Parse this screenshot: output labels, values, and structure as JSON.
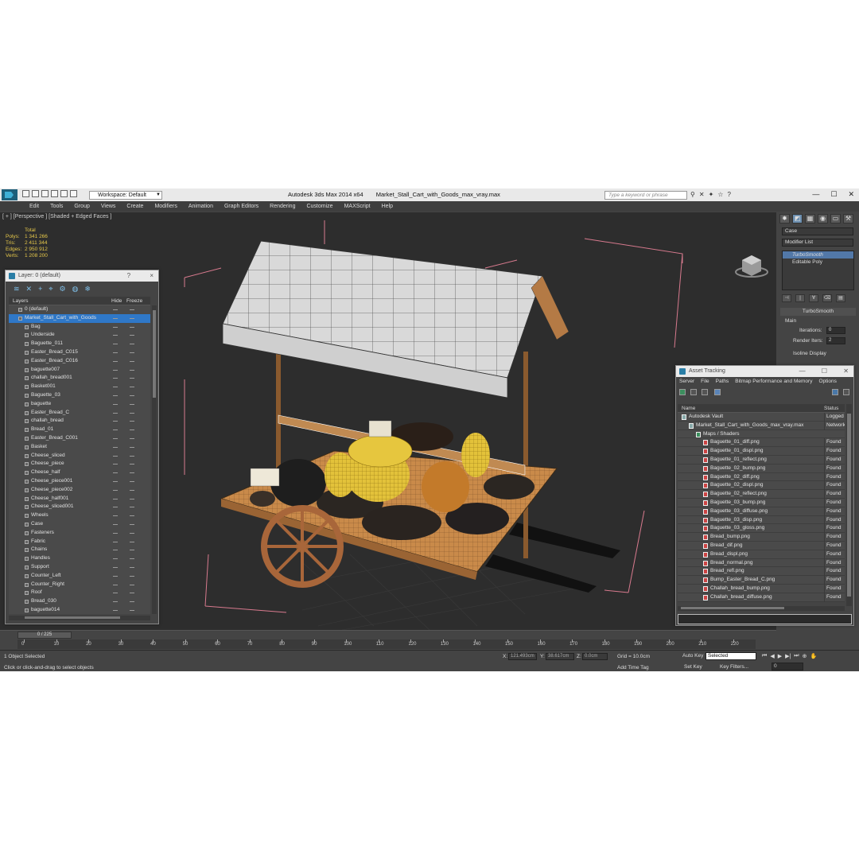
{
  "titlebar": {
    "workspace": "Workspace: Default",
    "app_title": "Autodesk 3ds Max  2014 x64",
    "file_name": "Market_Stall_Cart_with_Goods_max_vray.max",
    "search_placeholder": "Type a keyword or phrase"
  },
  "menu": [
    "Edit",
    "Tools",
    "Group",
    "Views",
    "Create",
    "Modifiers",
    "Animation",
    "Graph Editors",
    "Rendering",
    "Customize",
    "MAXScript",
    "Help"
  ],
  "viewport": {
    "label": "[ + ] [Perspective ] [Shaded + Edged Faces ]",
    "stats_header": "Total",
    "stats": [
      {
        "k": "Polys:",
        "v": "1 341 266"
      },
      {
        "k": "Tris:",
        "v": "2 411 344"
      },
      {
        "k": "Edges:",
        "v": "2 950 912"
      },
      {
        "k": "Verts:",
        "v": "1 208 200"
      }
    ]
  },
  "layer_panel": {
    "title": "Layer: 0 (default)",
    "help": "?",
    "close": "×",
    "col_layers": "Layers",
    "col_hide": "Hide",
    "col_freeze": "Freeze",
    "rows": [
      {
        "label": "0 (default)",
        "top": true
      },
      {
        "label": "Market_Stall_Cart_with_Goods",
        "top": true,
        "selected": true
      },
      {
        "label": "Bag"
      },
      {
        "label": "Underside"
      },
      {
        "label": "Baguette_011"
      },
      {
        "label": "Easter_Bread_C015"
      },
      {
        "label": "Easter_Bread_C016"
      },
      {
        "label": "baguette007"
      },
      {
        "label": "challah_bread001"
      },
      {
        "label": "Basket001"
      },
      {
        "label": "Baguette_03"
      },
      {
        "label": "baguette"
      },
      {
        "label": "Easter_Bread_C"
      },
      {
        "label": "challah_bread"
      },
      {
        "label": "Bread_01"
      },
      {
        "label": "Easter_Bread_C001"
      },
      {
        "label": "Basket"
      },
      {
        "label": "Cheese_sliced"
      },
      {
        "label": "Cheese_piece"
      },
      {
        "label": "Cheese_half"
      },
      {
        "label": "Cheese_piece001"
      },
      {
        "label": "Cheese_piece002"
      },
      {
        "label": "Cheese_half001"
      },
      {
        "label": "Cheese_sliced001"
      },
      {
        "label": "Wheels"
      },
      {
        "label": "Case"
      },
      {
        "label": "Fasteners"
      },
      {
        "label": "Fabric"
      },
      {
        "label": "Chains"
      },
      {
        "label": "Handles"
      },
      {
        "label": "Support"
      },
      {
        "label": "Counter_Left"
      },
      {
        "label": "Counter_Right"
      },
      {
        "label": "Roof"
      },
      {
        "label": "Bread_030"
      },
      {
        "label": "baguette014"
      }
    ]
  },
  "asset_panel": {
    "title": "Asset Tracking",
    "menu": [
      "Server",
      "File",
      "Paths",
      "Bitmap Performance and Memory",
      "Options"
    ],
    "col_name": "Name",
    "col_status": "Status",
    "rows": [
      {
        "name": "Autodesk Vault",
        "status": "Logged Out",
        "indent": 0
      },
      {
        "name": "Market_Stall_Cart_with_Goods_max_vray.max",
        "status": "Network",
        "indent": 1
      },
      {
        "name": "Maps / Shaders",
        "status": "",
        "indent": 2
      },
      {
        "name": "Baguette_01_diff.png",
        "status": "Found",
        "indent": 3
      },
      {
        "name": "Baguette_01_displ.png",
        "status": "Found",
        "indent": 3
      },
      {
        "name": "Baguette_01_reflect.png",
        "status": "Found",
        "indent": 3
      },
      {
        "name": "Baguette_02_bump.png",
        "status": "Found",
        "indent": 3
      },
      {
        "name": "Baguette_02_diff.png",
        "status": "Found",
        "indent": 3
      },
      {
        "name": "Baguette_02_displ.png",
        "status": "Found",
        "indent": 3
      },
      {
        "name": "Baguette_02_reflect.png",
        "status": "Found",
        "indent": 3
      },
      {
        "name": "Baguette_03_bump.png",
        "status": "Found",
        "indent": 3
      },
      {
        "name": "Baguette_03_diffuse.png",
        "status": "Found",
        "indent": 3
      },
      {
        "name": "Baguette_03_disp.png",
        "status": "Found",
        "indent": 3
      },
      {
        "name": "Baguette_03_gloss.png",
        "status": "Found",
        "indent": 3
      },
      {
        "name": "Bread_bump.png",
        "status": "Found",
        "indent": 3
      },
      {
        "name": "Bread_dif.png",
        "status": "Found",
        "indent": 3
      },
      {
        "name": "Bread_displ.png",
        "status": "Found",
        "indent": 3
      },
      {
        "name": "Bread_normal.png",
        "status": "Found",
        "indent": 3
      },
      {
        "name": "Bread_refl.png",
        "status": "Found",
        "indent": 3
      },
      {
        "name": "Bump_Easter_Bread_C.png",
        "status": "Found",
        "indent": 3
      },
      {
        "name": "Challah_bread_bump.png",
        "status": "Found",
        "indent": 3
      },
      {
        "name": "Challah_bread_diffuse.png",
        "status": "Found",
        "indent": 3
      }
    ]
  },
  "command_panel": {
    "object_name": "Case",
    "modifier_list": "Modifier List",
    "stack": [
      "TurboSmooth",
      "Editable Poly"
    ],
    "rollout": "TurboSmooth",
    "main": "Main",
    "iterations_label": "Iterations:",
    "iterations_value": "0",
    "render_iters_label": "Render Iters:",
    "render_iters_value": "2",
    "isoline": "Isoline Display"
  },
  "timeline": {
    "slider": "0 / 225",
    "progress": 0.0,
    "ticks": [
      "0",
      "10",
      "20",
      "30",
      "40",
      "50",
      "60",
      "70",
      "80",
      "90",
      "100",
      "110",
      "120",
      "130",
      "140",
      "150",
      "160",
      "170",
      "180",
      "190",
      "200",
      "210",
      "220"
    ]
  },
  "status": {
    "selection": "1 Object Selected",
    "prompt": "Click or click-and-drag to select objects",
    "x_label": "X:",
    "x_value": "121.493cm",
    "y_label": "Y:",
    "y_value": "38.617cm",
    "z_label": "Z:",
    "z_value": "0.0cm",
    "grid": "Grid = 10.0cm",
    "add_time_tag": "Add Time Tag",
    "auto_key": "Auto Key",
    "set_key": "Set Key",
    "selected": "Selected",
    "key_filters": "Key Filters...",
    "frame": "0"
  }
}
